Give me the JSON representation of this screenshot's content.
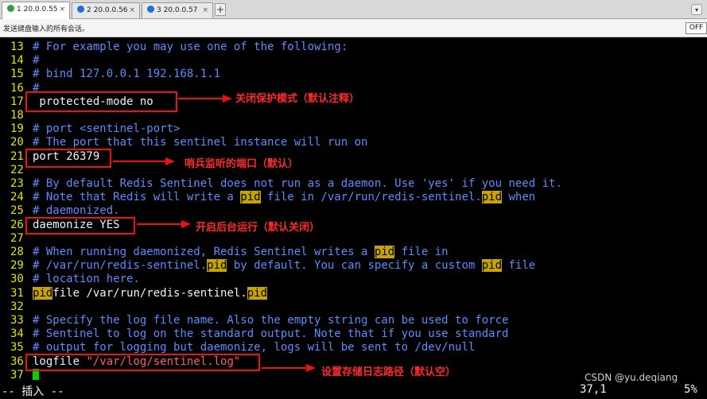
{
  "tabs": [
    {
      "label": "1 20.0.0.55",
      "status_color": "#2ea043",
      "active": true
    },
    {
      "label": "2 20.0.0.56",
      "status_color": "#1e6fd9",
      "active": false
    },
    {
      "label": "3 20.0.0.57",
      "status_color": "#1e6fd9",
      "active": false
    }
  ],
  "tab_close_glyph": "×",
  "tab_add_label": "+",
  "tab_menu_icon": "chevron-down-icon",
  "input_bar": {
    "send_label": "发送键盘输入的所有会话。",
    "off_button": "OFF"
  },
  "editor": {
    "lines": [
      {
        "num": "13",
        "text": "# For example you may use one of the following:"
      },
      {
        "num": "14",
        "text": "#"
      },
      {
        "num": "15",
        "text": "# bind 127.0.0.1 192.168.1.1"
      },
      {
        "num": "16",
        "text": "#"
      },
      {
        "num": "17",
        "text": " protected-mode no"
      },
      {
        "num": "18",
        "text": ""
      },
      {
        "num": "19",
        "text": "# port <sentinel-port>"
      },
      {
        "num": "20",
        "text": "# The port that this sentinel instance will run on"
      },
      {
        "num": "21",
        "text": "port 26379"
      },
      {
        "num": "22",
        "text": ""
      },
      {
        "num": "23",
        "text": "# By default Redis Sentinel does not run as a daemon. Use 'yes' if you need it."
      },
      {
        "num": "24",
        "text": "# Note that Redis will write a pid file in /var/run/redis-sentinel.pid when"
      },
      {
        "num": "25",
        "text": "# daemonized."
      },
      {
        "num": "26",
        "text": "daemonize YES"
      },
      {
        "num": "27",
        "text": ""
      },
      {
        "num": "28",
        "text": "# When running daemonized, Redis Sentinel writes a pid file in"
      },
      {
        "num": "29",
        "text": "# /var/run/redis-sentinel.pid by default. You can specify a custom pid file"
      },
      {
        "num": "30",
        "text": "# location here."
      },
      {
        "num": "31",
        "text": "pidfile /var/run/redis-sentinel.pid"
      },
      {
        "num": "32",
        "text": ""
      },
      {
        "num": "33",
        "text": "# Specify the log file name. Also the empty string can be used to force"
      },
      {
        "num": "34",
        "text": "# Sentinel to log on the standard output. Note that if you use standard"
      },
      {
        "num": "35",
        "text": "# output for logging but daemonize, logs will be sent to /dev/null"
      },
      {
        "num": "36",
        "text": "logfile \"/var/log/sentinel.log\""
      },
      {
        "num": "37",
        "text": ""
      }
    ],
    "colors": {
      "line_number": "#e4e400",
      "comment": "#5c8cff",
      "normal": "#f2f2f2",
      "string": "#ff5f5f",
      "search_highlight": "#c7a500",
      "cursor": "#00d200",
      "annotation": "#ff2a2a"
    },
    "search_term": "pid"
  },
  "annotations": [
    {
      "text": "关闭保护模式（默认注释）"
    },
    {
      "text": "哨兵监听的端口（默认）"
    },
    {
      "text": "开启后台运行（默认关闭）"
    },
    {
      "text": "设置存储日志路径（默认空）"
    }
  ],
  "status": {
    "mode": "-- 插入 --",
    "position": "37,1",
    "percent": "5%"
  },
  "watermark": "CSDN @yu.deqiang"
}
